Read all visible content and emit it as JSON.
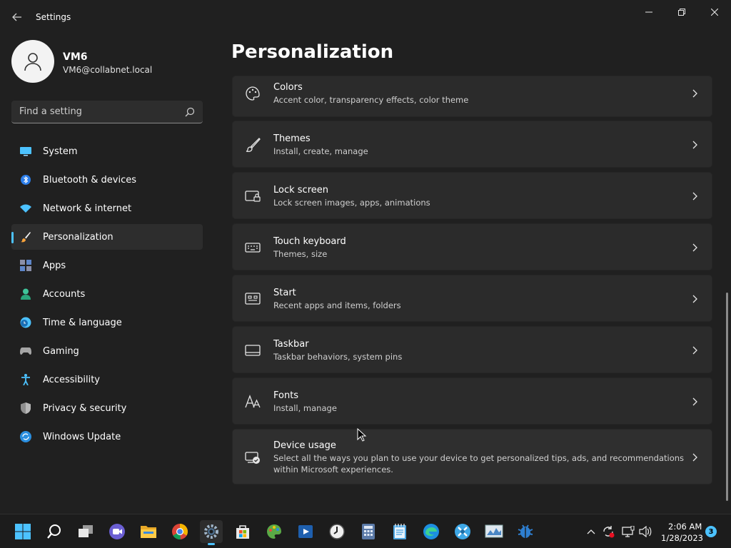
{
  "window": {
    "title": "Settings",
    "controls": [
      "minimize-icon",
      "restore-icon",
      "close-icon"
    ]
  },
  "user": {
    "name": "VM6",
    "email": "VM6@collabnet.local"
  },
  "search": {
    "placeholder": "Find a setting"
  },
  "sidebar": {
    "items": [
      {
        "label": "System",
        "icon": "monitor-icon"
      },
      {
        "label": "Bluetooth & devices",
        "icon": "bluetooth-icon"
      },
      {
        "label": "Network & internet",
        "icon": "wifi-icon"
      },
      {
        "label": "Personalization",
        "icon": "brush-icon",
        "active": true
      },
      {
        "label": "Apps",
        "icon": "apps-icon"
      },
      {
        "label": "Accounts",
        "icon": "person-icon"
      },
      {
        "label": "Time & language",
        "icon": "clock-globe-icon"
      },
      {
        "label": "Gaming",
        "icon": "gamepad-icon"
      },
      {
        "label": "Accessibility",
        "icon": "accessibility-icon"
      },
      {
        "label": "Privacy & security",
        "icon": "shield-icon"
      },
      {
        "label": "Windows Update",
        "icon": "update-icon"
      }
    ]
  },
  "main": {
    "title": "Personalization",
    "cards": [
      {
        "title": "Colors",
        "desc": "Accent color, transparency effects, color theme",
        "icon": "palette-icon"
      },
      {
        "title": "Themes",
        "desc": "Install, create, manage",
        "icon": "brush-icon"
      },
      {
        "title": "Lock screen",
        "desc": "Lock screen images, apps, animations",
        "icon": "lock-screen-icon"
      },
      {
        "title": "Touch keyboard",
        "desc": "Themes, size",
        "icon": "keyboard-icon"
      },
      {
        "title": "Start",
        "desc": "Recent apps and items, folders",
        "icon": "start-icon"
      },
      {
        "title": "Taskbar",
        "desc": "Taskbar behaviors, system pins",
        "icon": "taskbar-icon"
      },
      {
        "title": "Fonts",
        "desc": "Install, manage",
        "icon": "fonts-icon"
      },
      {
        "title": "Device usage",
        "desc": "Select all the ways you plan to use your device to get personalized tips, ads, and recommendations within Microsoft experiences.",
        "icon": "device-usage-icon"
      }
    ]
  },
  "taskbar": {
    "apps": [
      "windows-start-icon",
      "search-icon",
      "task-view-icon",
      "teams-chat-icon",
      "file-explorer-icon",
      "chrome-icon",
      "settings-icon",
      "store-icon",
      "paint-icon",
      "media-icon",
      "clock-app-icon",
      "calculator-icon",
      "notepad-icon",
      "edge-icon",
      "tool-icon",
      "monitor-app-icon",
      "bug-icon"
    ],
    "tray": [
      "chevron-up-icon",
      "sync-icon",
      "display-icon",
      "volume-icon"
    ],
    "time": "2:06 AM",
    "date": "1/28/2023",
    "notification_count": "3"
  },
  "colors": {
    "accent": "#4cc2ff",
    "background": "#202020",
    "card": "#2b2b2b"
  }
}
